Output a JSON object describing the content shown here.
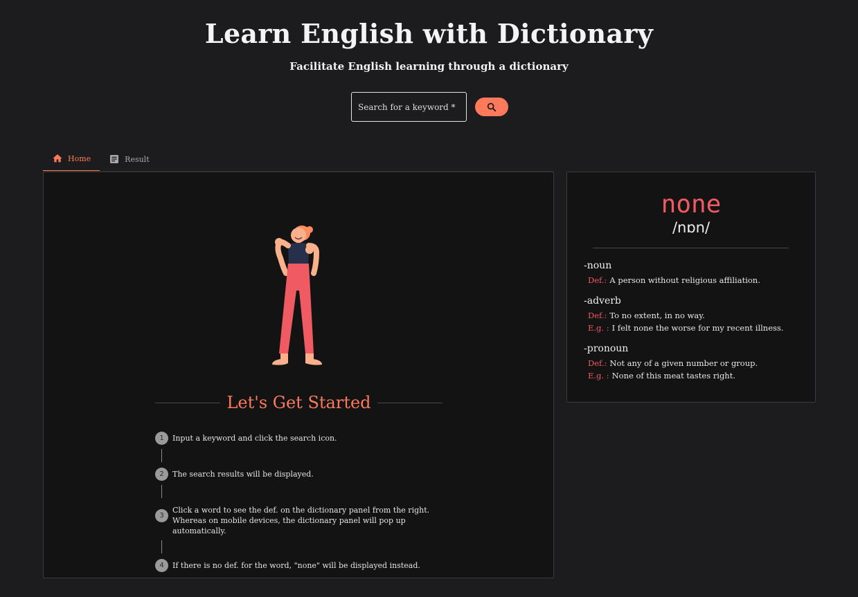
{
  "header": {
    "title": "Learn English with Dictionary",
    "subtitle": "Facilitate English learning through a dictionary"
  },
  "search": {
    "placeholder": "Search for a keyword *",
    "value": "",
    "button_icon": "search-icon"
  },
  "tabs": [
    {
      "label": "Home",
      "icon": "home-icon",
      "active": true
    },
    {
      "label": "Result",
      "icon": "article-icon",
      "active": false
    }
  ],
  "home": {
    "heading": "Let's Get Started",
    "steps": [
      {
        "num": "1",
        "text": "Input a keyword and click the search icon."
      },
      {
        "num": "2",
        "text": "The search results will be displayed."
      },
      {
        "num": "3",
        "text": "Click a word to see the def. on the dictionary panel from the right. Whereas on mobile devices, the dictionary panel will pop up automatically."
      },
      {
        "num": "4",
        "text": "If there is no def. for the word, \"none\" will be displayed instead."
      }
    ]
  },
  "dictionary": {
    "word": "none",
    "phonetic": "/nɒn/",
    "def_label": "Def.:",
    "eg_label": "E.g. :",
    "entries": [
      {
        "pos": "-noun",
        "def": "A person without religious affiliation.",
        "example": ""
      },
      {
        "pos": "-adverb",
        "def": "To no extent, in no way.",
        "example": "I felt none the worse for my recent illness."
      },
      {
        "pos": "-pronoun",
        "def": "Not any of a given number or group.",
        "example": "None of this meat tastes right."
      }
    ]
  },
  "colors": {
    "accent": "#ff7a5a",
    "word": "#f05a62",
    "background": "#1c1c1e",
    "panel": "#131314"
  }
}
